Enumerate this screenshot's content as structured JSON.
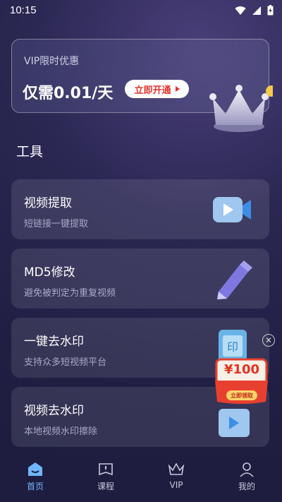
{
  "status_bar": {
    "time": "10:15"
  },
  "vip_banner": {
    "caption": "VIP限时优惠",
    "price": "仅需0.01/天",
    "button_label": "立即开通"
  },
  "tools_title": "工具",
  "tools": [
    {
      "title": "视频提取",
      "subtitle": "短链接一键提取"
    },
    {
      "title": "MD5修改",
      "subtitle": "避免被判定为重复视频"
    },
    {
      "title": "一键去水印",
      "subtitle": "支持众多短视频平台"
    },
    {
      "title": "视频去水印",
      "subtitle": "本地视频水印擦除"
    }
  ],
  "coupon": {
    "amount": "¥100",
    "button_label": "立即领取"
  },
  "tabbar": [
    {
      "label": "首页",
      "active": true
    },
    {
      "label": "课程",
      "active": false
    },
    {
      "label": "VIP",
      "active": false
    },
    {
      "label": "我的",
      "active": false
    }
  ],
  "colors": {
    "accent_red": "#e0342c",
    "tab_active": "#6fb6ff"
  }
}
